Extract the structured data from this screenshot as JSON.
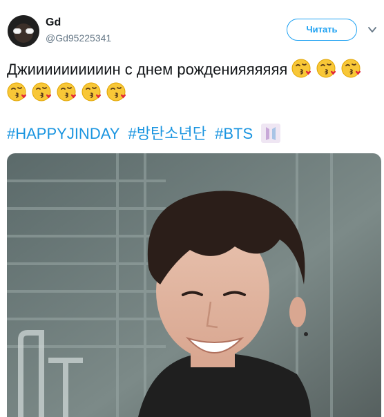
{
  "tweet": {
    "author": {
      "display_name": "Gd",
      "handle": "@Gd95225341",
      "avatar_icon": "avatar-with-sunglasses"
    },
    "follow_label": "Читать",
    "text": "Джиииииииииин с днем рожденияяяяяя",
    "emoji_icon": "face-blowing-kiss-icon",
    "emoji_count": 8,
    "hashtags": [
      "#HAPPYJINDAY",
      "#방탄소년단",
      "#BTS"
    ],
    "hashtag_emoji_icon": "bts-logo-icon",
    "media": {
      "type": "photo",
      "icon": "photo-of-smiling-person"
    }
  },
  "colors": {
    "link": "#1b95e0",
    "follow_border": "#1da1f2",
    "handle": "#657786",
    "text": "#14171a"
  }
}
